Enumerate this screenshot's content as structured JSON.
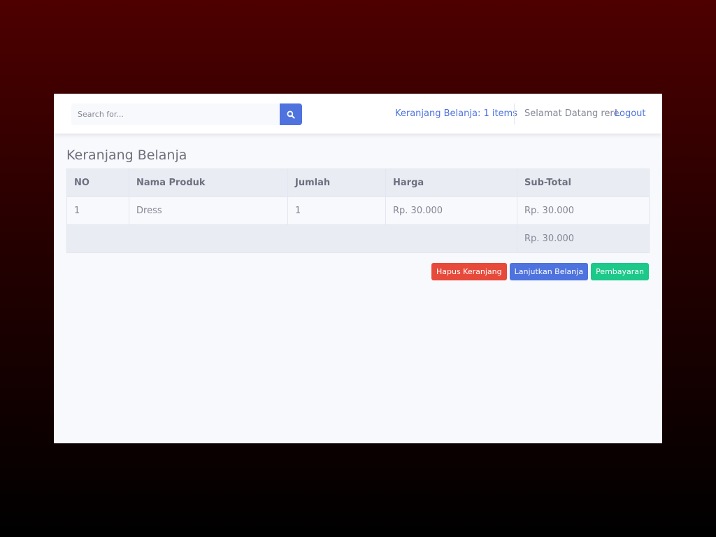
{
  "search": {
    "placeholder": "Search for..."
  },
  "topbar": {
    "cart_link": "Keranjang Belanja: 1 items",
    "greeting": "Selamat Datang rere",
    "logout": "Logout"
  },
  "page": {
    "title": "Keranjang Belanja"
  },
  "table": {
    "headers": [
      "NO",
      "Nama Produk",
      "Jumlah",
      "Harga",
      "Sub-Total"
    ],
    "rows": [
      [
        "1",
        "Dress",
        "1",
        "Rp. 30.000",
        "Rp. 30.000"
      ]
    ],
    "total": "Rp. 30.000"
  },
  "actions": {
    "clear_cart": "Hapus Keranjang",
    "continue_shopping": "Lanjutkan Belanja",
    "checkout": "Pembayaran"
  },
  "colors": {
    "primary": "#4e73df",
    "danger": "#e74a3b",
    "success": "#1cc88a",
    "text_muted": "#858796"
  },
  "icons": {
    "search_button": "search-icon"
  }
}
